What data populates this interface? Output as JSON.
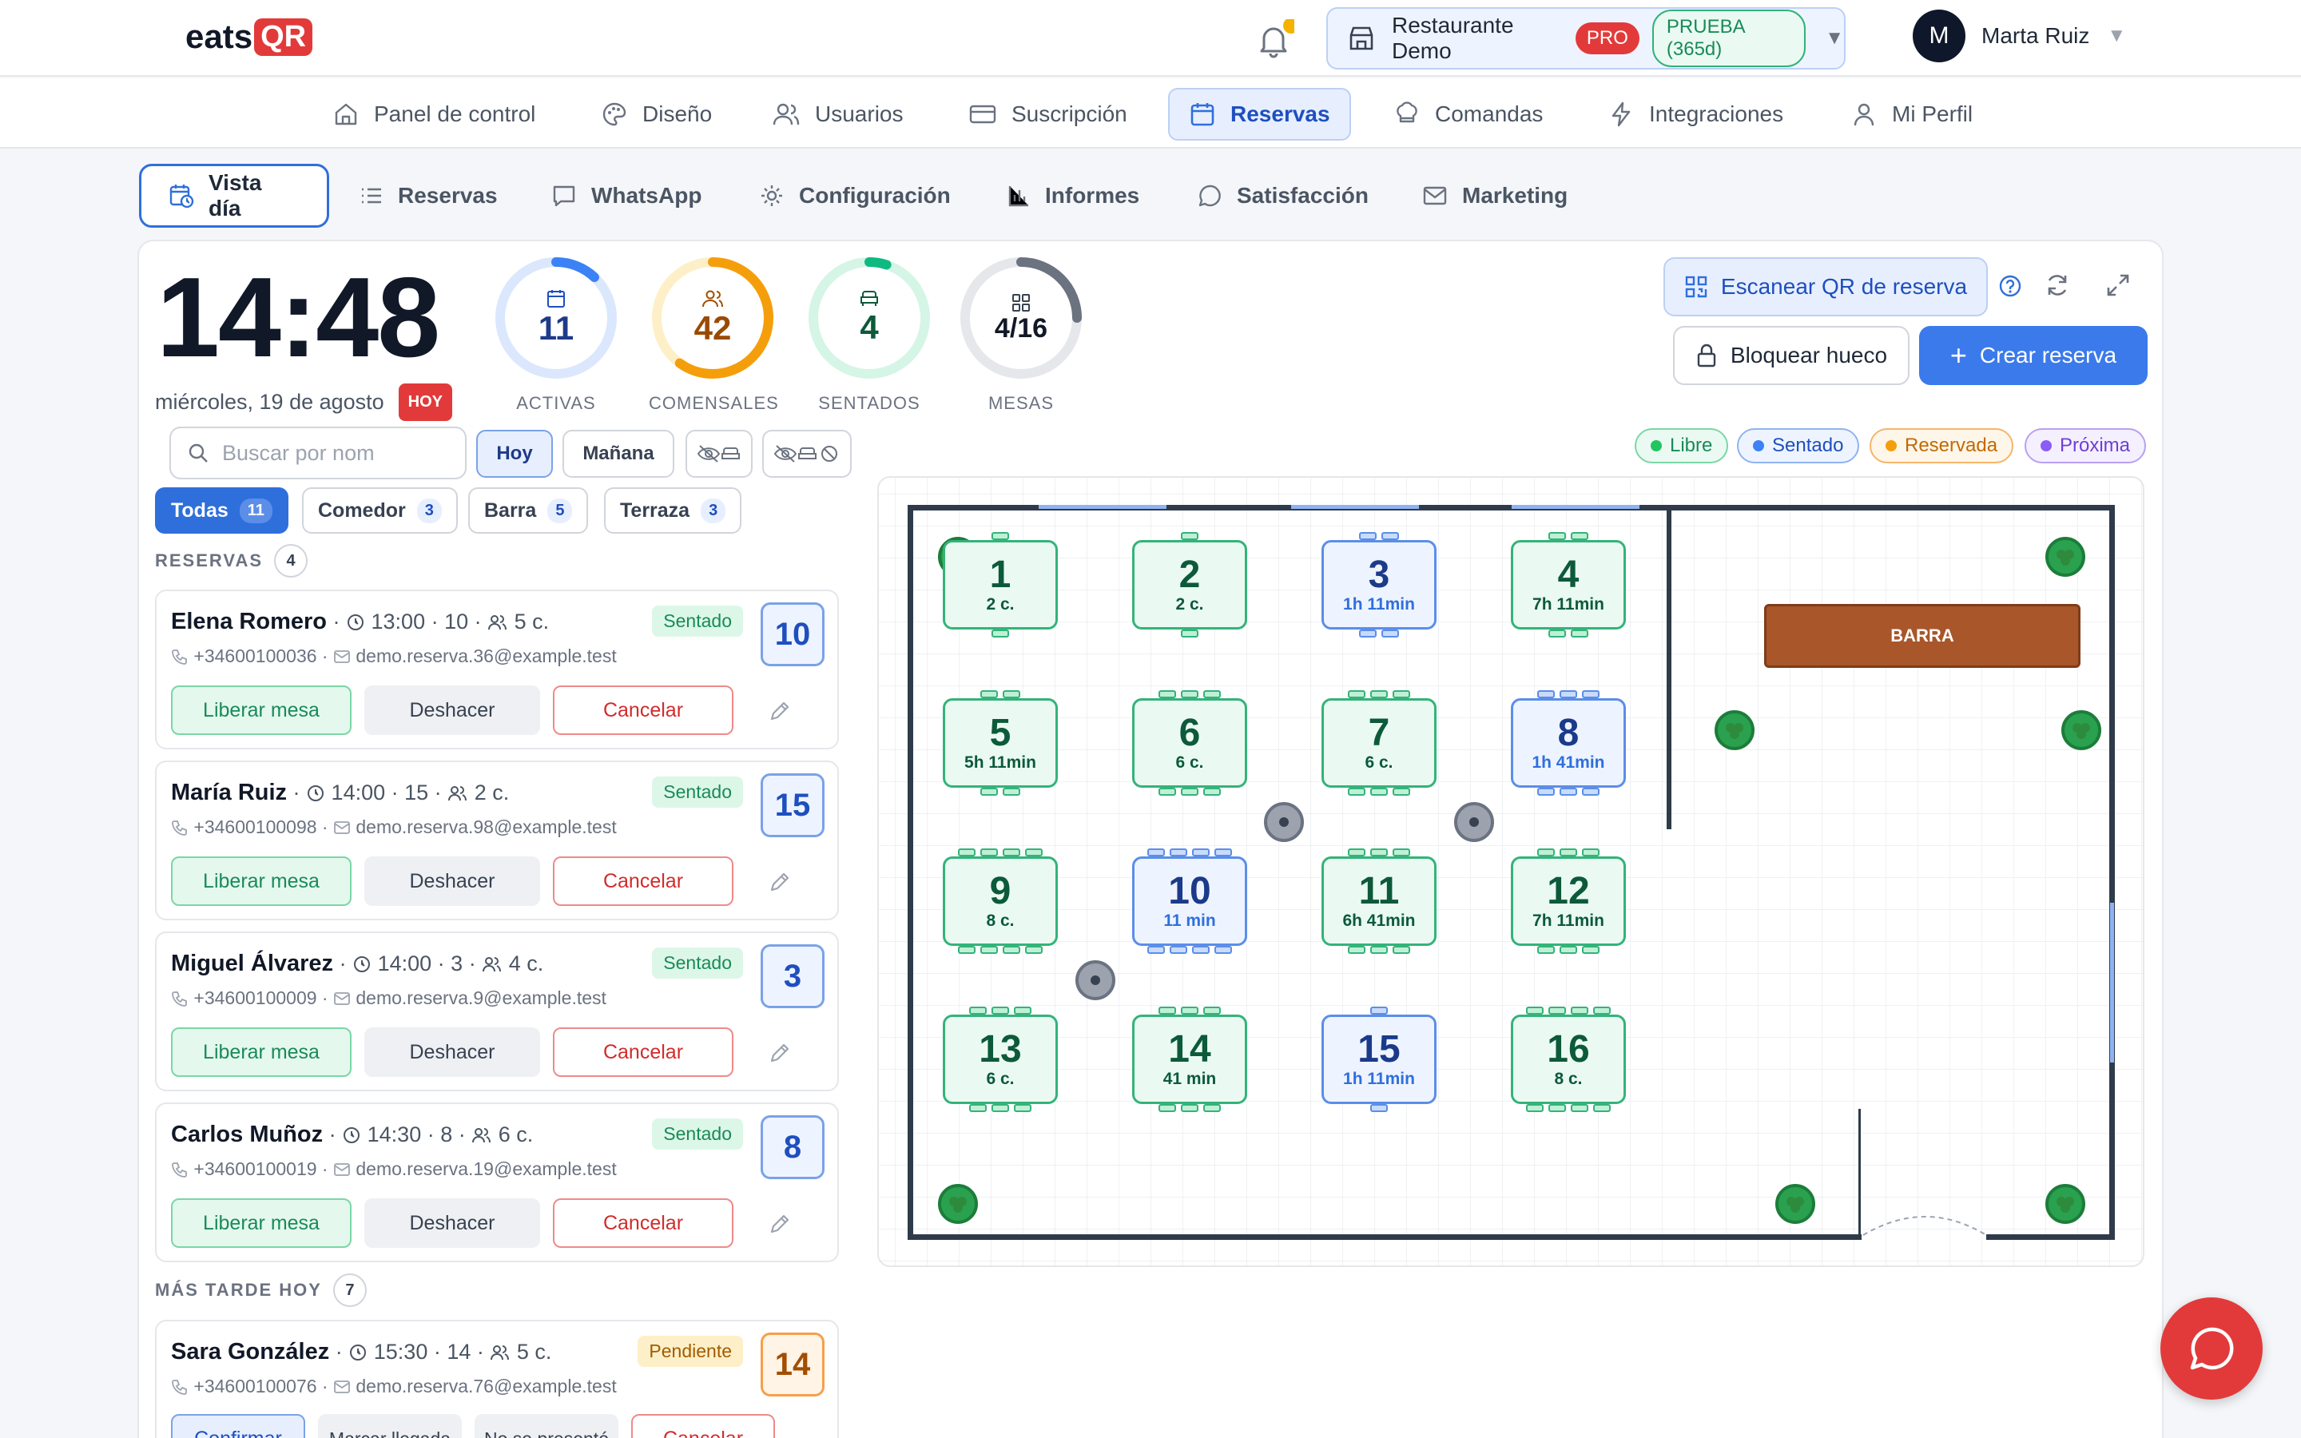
{
  "brand": {
    "logo_text": "eats",
    "logo_badge": "QR"
  },
  "header": {
    "restaurant": "Restaurante Demo",
    "plan_badge": "PRO",
    "trial_badge": "PRUEBA (365d)",
    "user_initial": "M",
    "user_name": "Marta Ruiz"
  },
  "nav": {
    "items": [
      {
        "label": "Panel de control",
        "icon": "home-icon"
      },
      {
        "label": "Diseño",
        "icon": "palette-icon"
      },
      {
        "label": "Usuarios",
        "icon": "users-icon"
      },
      {
        "label": "Suscripción",
        "icon": "card-icon"
      },
      {
        "label": "Reservas",
        "icon": "calendar-icon",
        "active": true
      },
      {
        "label": "Comandas",
        "icon": "chef-hat-icon"
      },
      {
        "label": "Integraciones",
        "icon": "bolt-icon"
      },
      {
        "label": "Mi Perfil",
        "icon": "user-icon"
      }
    ]
  },
  "subtabs": {
    "items": [
      {
        "label": "Vista día",
        "active": true
      },
      {
        "label": "Reservas"
      },
      {
        "label": "WhatsApp"
      },
      {
        "label": "Configuración"
      },
      {
        "label": "Informes"
      },
      {
        "label": "Satisfacción"
      },
      {
        "label": "Marketing"
      }
    ]
  },
  "summary": {
    "time": "14:48",
    "date": "miércoles, 19 de agosto",
    "today_badge": "HOY",
    "stats": [
      {
        "label": "ACTIVAS",
        "value": "11",
        "fraction": 0.12,
        "color": "#3b82f6",
        "track": "#dbe7fd"
      },
      {
        "label": "COMENSALES",
        "value": "42",
        "fraction": 0.6,
        "color": "#f59e0b",
        "track": "#fdf0c8"
      },
      {
        "label": "SENTADOS",
        "value": "4",
        "fraction": 0.05,
        "color": "#10b981",
        "track": "#d5f5e6"
      },
      {
        "label": "MESAS",
        "value": "4/16",
        "fraction": 0.25,
        "color": "#6b7280",
        "track": "#e5e7eb"
      }
    ]
  },
  "actions": {
    "scan_qr": "Escanear QR de reserva",
    "block_slot": "Bloquear hueco",
    "create": "Crear reserva"
  },
  "legend": [
    {
      "label": "Libre",
      "color": "#22c55e"
    },
    {
      "label": "Sentado",
      "color": "#3b82f6"
    },
    {
      "label": "Reservada",
      "color": "#f59e0b"
    },
    {
      "label": "Próxima",
      "color": "#8b5cf6"
    }
  ],
  "search": {
    "placeholder": "Buscar por nom"
  },
  "day_filters": {
    "today": "Hoy",
    "tomorrow": "Mañana"
  },
  "zone_filters": [
    {
      "label": "Todas",
      "count": "11",
      "active": true
    },
    {
      "label": "Comedor",
      "count": "3"
    },
    {
      "label": "Barra",
      "count": "5"
    },
    {
      "label": "Terraza",
      "count": "3"
    }
  ],
  "sections": {
    "reservas": {
      "title": "RESERVAS",
      "count": "4"
    },
    "later": {
      "title": "MÁS TARDE HOY",
      "count": "7"
    }
  },
  "reservations": [
    {
      "name": "Elena Romero",
      "time": "13:00",
      "table": "10",
      "guests": "5 c.",
      "phone": "+34600100036",
      "email": "demo.reserva.36@example.test",
      "status": "Sentado"
    },
    {
      "name": "María Ruiz",
      "time": "14:00",
      "table": "15",
      "guests": "2 c.",
      "phone": "+34600100098",
      "email": "demo.reserva.98@example.test",
      "status": "Sentado"
    },
    {
      "name": "Miguel Álvarez",
      "time": "14:00",
      "table": "3",
      "guests": "4 c.",
      "phone": "+34600100009",
      "email": "demo.reserva.9@example.test",
      "status": "Sentado"
    },
    {
      "name": "Carlos Muñoz",
      "time": "14:30",
      "table": "8",
      "guests": "6 c.",
      "phone": "+34600100019",
      "email": "demo.reserva.19@example.test",
      "status": "Sentado"
    }
  ],
  "seated_actions": {
    "release": "Liberar mesa",
    "undo": "Deshacer",
    "cancel": "Cancelar"
  },
  "later_reservations": [
    {
      "name": "Sara González",
      "time": "15:30",
      "table": "14",
      "guests": "5 c.",
      "phone": "+34600100076",
      "email": "demo.reserva.76@example.test",
      "status": "Pendiente"
    }
  ],
  "pending_actions": {
    "confirm": "Confirmar",
    "arrived": "Marcar llegada",
    "noshow": "No se presentó",
    "cancel": "Cancelar"
  },
  "floor": {
    "bar_label": "BARRA",
    "tables": [
      {
        "n": "1",
        "sub": "2 c.",
        "state": "libre"
      },
      {
        "n": "2",
        "sub": "2 c.",
        "state": "libre"
      },
      {
        "n": "3",
        "sub": "1h 11min",
        "state": "sentado"
      },
      {
        "n": "4",
        "sub": "7h 11min",
        "state": "libre"
      },
      {
        "n": "5",
        "sub": "5h 11min",
        "state": "libre"
      },
      {
        "n": "6",
        "sub": "6 c.",
        "state": "libre"
      },
      {
        "n": "7",
        "sub": "6 c.",
        "state": "libre"
      },
      {
        "n": "8",
        "sub": "1h 41min",
        "state": "sentado"
      },
      {
        "n": "9",
        "sub": "8 c.",
        "state": "libre"
      },
      {
        "n": "10",
        "sub": "11 min",
        "state": "sentado"
      },
      {
        "n": "11",
        "sub": "6h 41min",
        "state": "libre"
      },
      {
        "n": "12",
        "sub": "7h 11min",
        "state": "libre"
      },
      {
        "n": "13",
        "sub": "6 c.",
        "state": "libre"
      },
      {
        "n": "14",
        "sub": "41 min",
        "state": "libre"
      },
      {
        "n": "15",
        "sub": "1h 11min",
        "state": "sentado"
      },
      {
        "n": "16",
        "sub": "8 c.",
        "state": "libre"
      }
    ]
  }
}
